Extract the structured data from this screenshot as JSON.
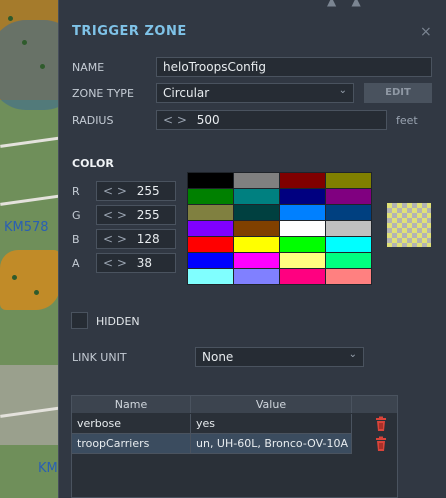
{
  "map": {
    "label_1": "KM578",
    "label_2": "KM"
  },
  "panel": {
    "title": "TRIGGER ZONE",
    "close_glyph": "×"
  },
  "name": {
    "label": "NAME",
    "value": "heloTroopsConfig"
  },
  "zone_type": {
    "label": "ZONE TYPE",
    "value": "Circular",
    "edit_label": "EDIT"
  },
  "radius": {
    "label": "RADIUS",
    "value": "500",
    "unit": "feet"
  },
  "color": {
    "title": "COLOR",
    "r": {
      "label": "R",
      "value": "255"
    },
    "g": {
      "label": "G",
      "value": "255"
    },
    "b": {
      "label": "B",
      "value": "128"
    },
    "a": {
      "label": "A",
      "value": "38"
    },
    "palette": [
      "#000000",
      "#808080",
      "#800000",
      "#808000",
      "#008000",
      "#008080",
      "#000080",
      "#800080",
      "#808040",
      "#004040",
      "#0080ff",
      "#004080",
      "#8000ff",
      "#804000",
      "#ffffff",
      "#c0c0c0",
      "#ff0000",
      "#ffff00",
      "#00ff00",
      "#00ffff",
      "#0000ff",
      "#ff00ff",
      "#ffff80",
      "#00ff80",
      "#80ffff",
      "#8080ff",
      "#ff0080",
      "#ff8080"
    ]
  },
  "hidden": {
    "label": "HIDDEN",
    "checked": false
  },
  "link_unit": {
    "label": "LINK UNIT",
    "value": "None"
  },
  "properties": {
    "headers": {
      "name": "Name",
      "value": "Value"
    },
    "rows": [
      {
        "name": "verbose",
        "value": "yes"
      },
      {
        "name": "troopCarriers",
        "value": "un, UH-60L, Bronco-OV-10A"
      }
    ]
  },
  "icons": {
    "arrows": "< >",
    "chevron": "⌄",
    "trash": "trash-icon"
  },
  "colors": {
    "accent": "#7fc3e8",
    "trash": "#d9443a"
  }
}
